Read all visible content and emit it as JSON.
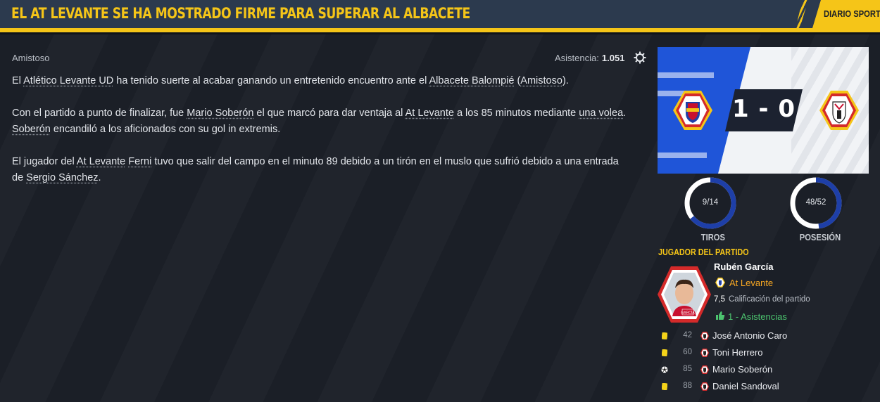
{
  "header": {
    "headline": "EL AT LEVANTE SE HA MOSTRADO FIRME PARA SUPERAR AL ALBACETE",
    "source": "DIARIO SPORT"
  },
  "meta": {
    "competition": "Amistoso",
    "attendance_label": "Asistencia:",
    "attendance_value": "1.051"
  },
  "article": {
    "p1": {
      "a": "El ",
      "team1": "Atlético Levante UD",
      "b": " ha tenido suerte al acabar ganando un entretenido encuentro ante el ",
      "team2": "Albacete Balompié",
      "c": " (",
      "comp": "Amistoso",
      "d": ")."
    },
    "p2": {
      "a": "Con el partido a punto de finalizar, fue ",
      "player": "Mario Soberón",
      "b": " el que marcó para dar ventaja al ",
      "team": "At Levante",
      "c": " a los 85 minutos mediante ",
      "shot": "una volea",
      "d": ". ",
      "player_short": "Soberón",
      "e": " encandiló a los aficionados con su gol in extremis."
    },
    "p3": {
      "a": "El jugador del ",
      "team": "At Levante",
      "b": " ",
      "player": "Ferni",
      "c": " tuvo que salir del campo en el minuto 89 debido a un tirón en el muslo que sufrió debido a una entrada de ",
      "opponent": "Sergio Sánchez",
      "d": "."
    }
  },
  "score": {
    "text": "1 - 0",
    "home_goals": 1,
    "away_goals": 0
  },
  "stats": {
    "shots": {
      "label": "9/14",
      "title": "TIROS",
      "fraction": 0.643
    },
    "possession": {
      "label": "48/52",
      "title": "POSESIÓN",
      "fraction": 0.48
    }
  },
  "potm": {
    "title": "JUGADOR DEL PARTIDO",
    "name": "Rubén García",
    "club": "At Levante",
    "rating": "7,5",
    "rating_label": "Calificación del partido",
    "assists": "1 - Asistencias",
    "photo_caption": "GARCÍA"
  },
  "events": [
    {
      "type": "yellow-card",
      "minute": "42",
      "player": "José Antonio Caro"
    },
    {
      "type": "yellow-card",
      "minute": "60",
      "player": "Toni Herrero"
    },
    {
      "type": "goal",
      "minute": "85",
      "player": "Mario Soberón"
    },
    {
      "type": "yellow-card",
      "minute": "88",
      "player": "Daniel Sandoval"
    }
  ],
  "colors": {
    "accent": "#f5c518",
    "header_bg": "#2c3a4e",
    "ring_fill": "#1e3fa8",
    "assist_green": "#4cc46f",
    "club_orange": "#f5a623"
  }
}
